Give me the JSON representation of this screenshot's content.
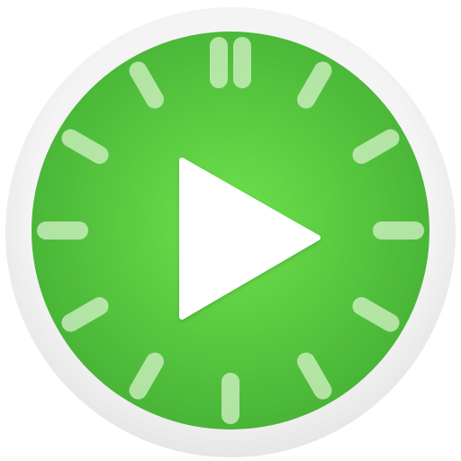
{
  "icon": {
    "name": "timer-play-icon",
    "colors": {
      "outer_ring": "#f4f4f4",
      "outer_ring_shadow": "#e6e6e6",
      "face_center": "#6ee24c",
      "face_edge": "#46b236",
      "tick": "#d4f2c8",
      "play": "#ffffff"
    },
    "tick_count": 12,
    "top_tick_style": "double"
  }
}
